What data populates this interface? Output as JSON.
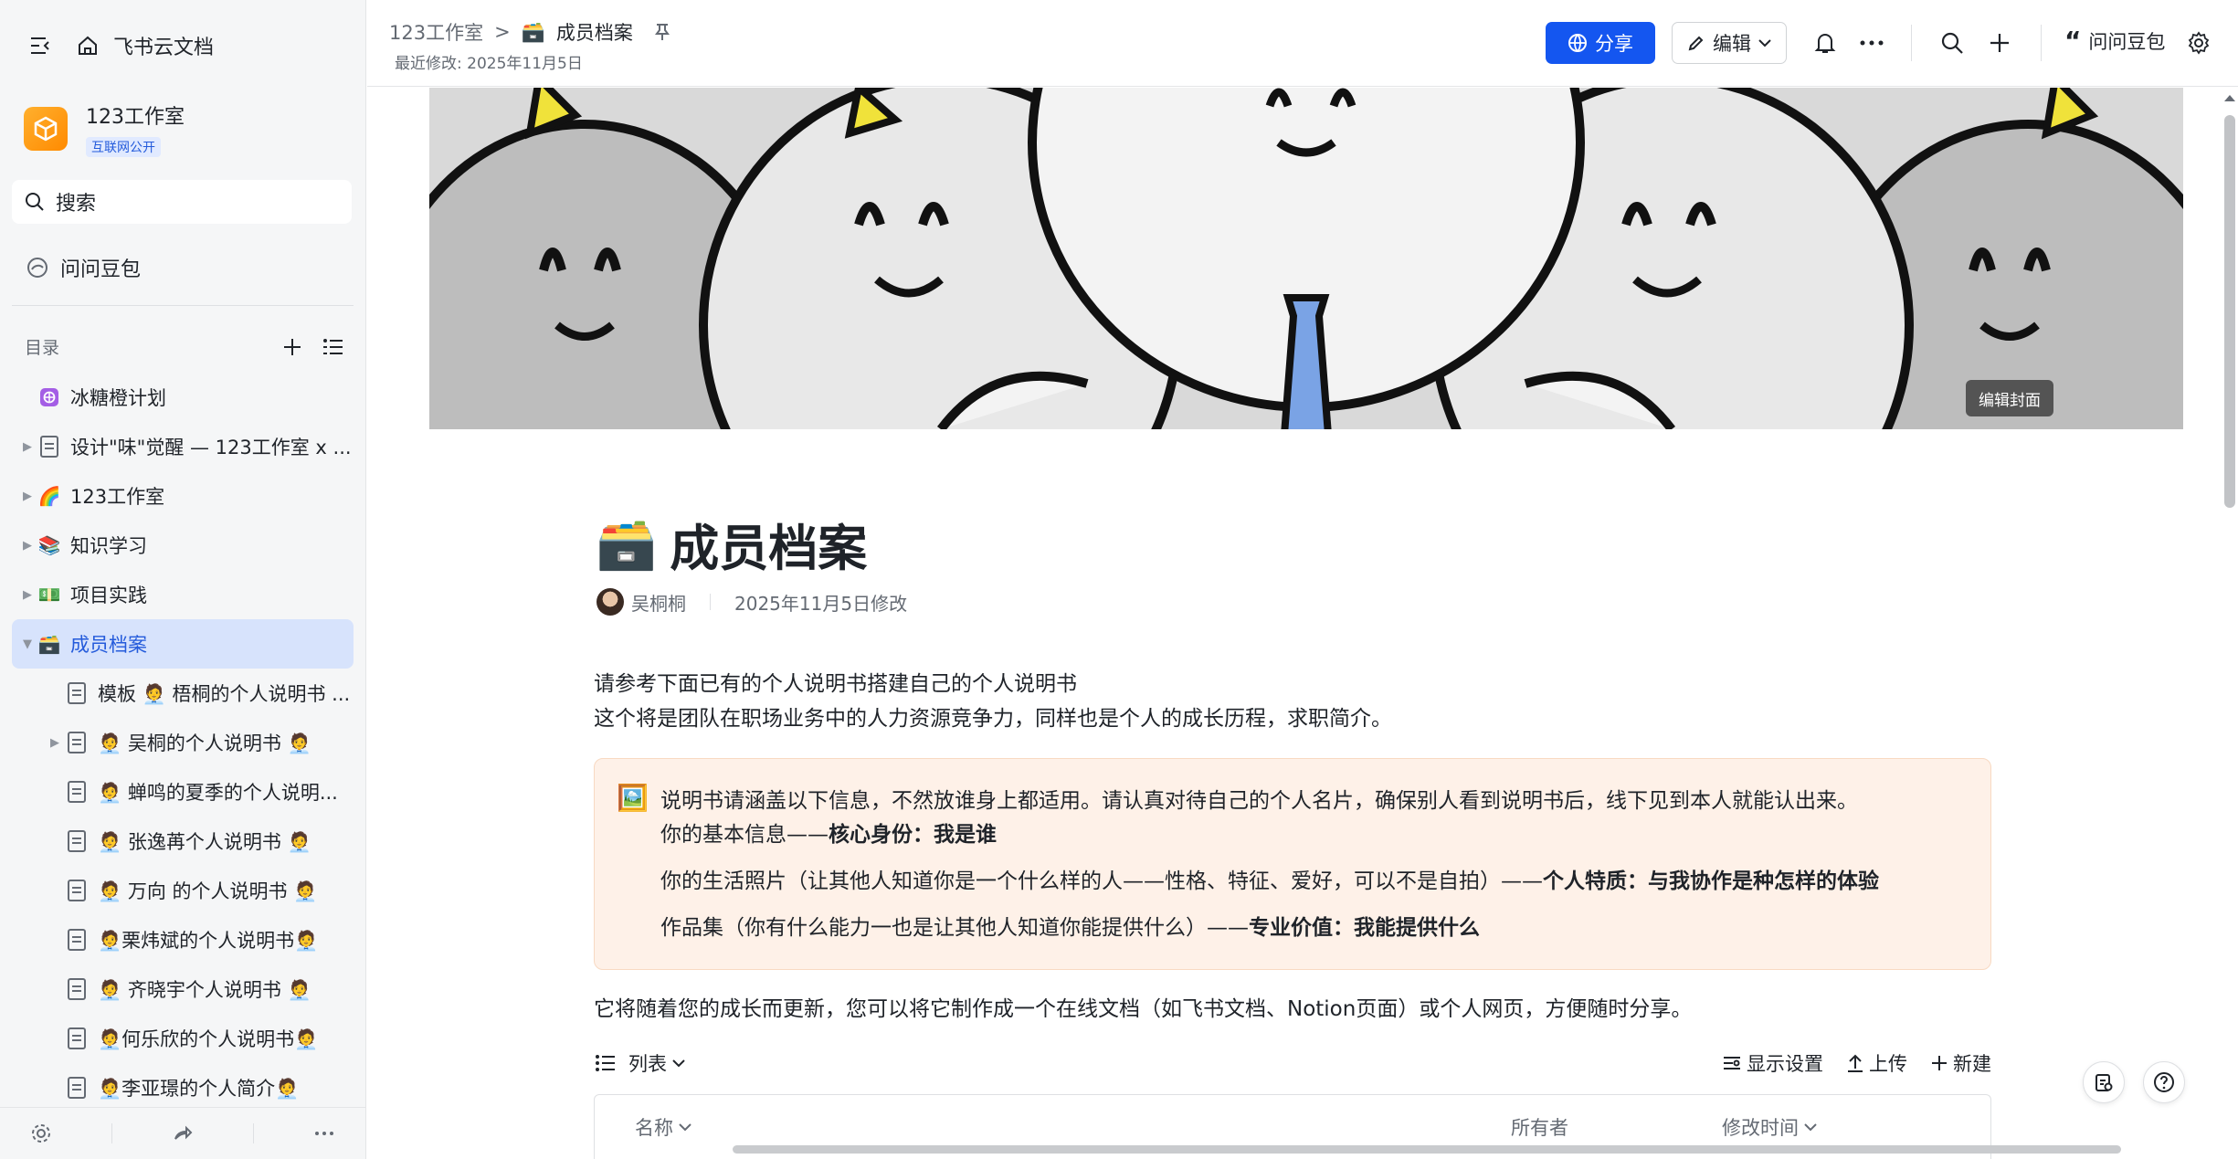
{
  "sidebar": {
    "app_title": "飞书云文档",
    "workspace": {
      "name": "123工作室",
      "badge": "互联网公开"
    },
    "search_placeholder": "搜索",
    "ask": "问问豆包",
    "toc_label": "目录",
    "items": [
      {
        "label": "冰糖橙计划",
        "icon": "grid-icon",
        "level": 0,
        "expand": ""
      },
      {
        "label": "设计\"味\"觉醒 — 123工作室 x ...",
        "icon": "doc-icon",
        "level": 0,
        "expand": "▶"
      },
      {
        "label": "123工作室",
        "icon": "🌈",
        "level": 0,
        "expand": "▶"
      },
      {
        "label": "知识学习",
        "icon": "📚",
        "level": 0,
        "expand": "▶"
      },
      {
        "label": "项目实践",
        "icon": "💵",
        "level": 0,
        "expand": "▶"
      },
      {
        "label": "成员档案",
        "icon": "🗃️",
        "level": 0,
        "expand": "▼",
        "active": true
      },
      {
        "label": "模板 🧑‍💼 梧桐的个人说明书 ...",
        "icon": "doc-icon",
        "level": 1,
        "expand": ""
      },
      {
        "label": "🧑‍💼 吴桐的个人说明书 🧑‍💼",
        "icon": "doc-icon",
        "level": 1,
        "expand": "▶"
      },
      {
        "label": "🧑‍💼 蝉鸣的夏季的个人说明...",
        "icon": "doc-icon",
        "level": 1,
        "expand": ""
      },
      {
        "label": "🧑‍💼 张逸苒个人说明书 🧑‍💼",
        "icon": "doc-icon",
        "level": 1,
        "expand": ""
      },
      {
        "label": "🧑‍💼 万向 的个人说明书 🧑‍💼",
        "icon": "doc-icon",
        "level": 1,
        "expand": ""
      },
      {
        "label": "🧑‍💼栗炜斌的个人说明书🧑‍💼",
        "icon": "doc-icon",
        "level": 1,
        "expand": ""
      },
      {
        "label": "🧑‍💼 齐晓宇个人说明书 🧑‍💼",
        "icon": "doc-icon",
        "level": 1,
        "expand": ""
      },
      {
        "label": "🧑‍💼何乐欣的个人说明书🧑‍💼",
        "icon": "doc-icon",
        "level": 1,
        "expand": ""
      },
      {
        "label": "🧑‍💼李亚璟的个人简介🧑‍💼",
        "icon": "doc-icon",
        "level": 1,
        "expand": ""
      }
    ]
  },
  "topbar": {
    "breadcrumb_root": "123工作室",
    "breadcrumb_sep": ">",
    "breadcrumb_current_icon": "🗃️",
    "breadcrumb_current": "成员档案",
    "last_modified": "最近修改: 2025年11月5日",
    "share_label": "分享",
    "edit_label": "编辑",
    "ask_label": "问问豆包"
  },
  "doc": {
    "cover_edit": "编辑封面",
    "title_icon": "🗃️",
    "title": "成员档案",
    "author": "吴桐桐",
    "modified": "2025年11月5日修改",
    "intro_1": "请参考下面已有的个人说明书搭建自己的个人说明书",
    "intro_2": "这个将是团队在职场业务中的人力资源竞争力，同样也是个人的成长历程，求职简介。",
    "callout": {
      "emoji": "🖼️",
      "line1": "说明书请涵盖以下信息，不然放谁身上都适用。请认真对待自己的个人名片，确保别人看到说明书后，线下见到本人就能认出来。",
      "line2_pre": "你的基本信息——",
      "line2_bold": "核心身份：我是谁",
      "line3_pre": "你的生活照片（让其他人知道你是一个什么样的人——性格、特征、爱好，可以不是自拍）——",
      "line3_bold": "个人特质：与我协作是种怎样的体验",
      "line4_pre": "作品集（你有什么能力一也是让其他人知道你能提供什么）——",
      "line4_bold": "专业价值：我能提供什么"
    },
    "outro": "它将随着您的成长而更新，您可以将它制作成一个在线文档（如飞书文档、Notion页面）或个人网页，方便随时分享。",
    "view": {
      "mode": "列表",
      "display": "显示设置",
      "upload": "上传",
      "new": "新建"
    },
    "table_headers": {
      "name": "名称",
      "owner": "所有者",
      "modified": "修改时间"
    }
  }
}
